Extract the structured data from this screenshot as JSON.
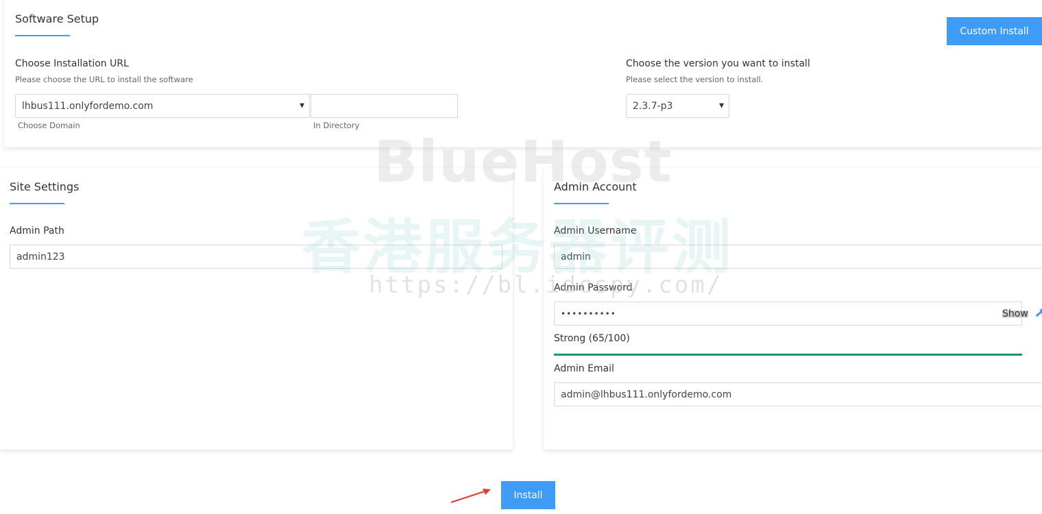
{
  "software_setup": {
    "title": "Software Setup",
    "custom_install_label": "Custom Install",
    "install_url": {
      "label": "Choose Installation URL",
      "hint": "Please choose the URL to install the software",
      "domain_value": "lhbus111.onlyfordemo.com",
      "domain_sublabel": "Choose Domain",
      "directory_value": "",
      "directory_sublabel": "In Directory"
    },
    "version": {
      "label": "Choose the version you want to install",
      "hint": "Please select the version to install.",
      "value": "2.3.7-p3"
    }
  },
  "site_settings": {
    "title": "Site Settings",
    "admin_path_label": "Admin Path",
    "admin_path_value": "admin123"
  },
  "admin_account": {
    "title": "Admin Account",
    "username_label": "Admin Username",
    "username_value": "admin",
    "password_label": "Admin Password",
    "password_value": "••••••••••",
    "show_label": "Show",
    "strength_text": "Strong (65/100)",
    "strength_fraction": 0.65,
    "email_label": "Admin Email",
    "email_value": "admin@lhbus111.onlyfordemo.com"
  },
  "install_button_label": "Install",
  "watermark": {
    "brand": "BlueHost",
    "chinese": "香港服务器评测",
    "url": "https://bl.idcspy.com/"
  },
  "colors": {
    "accent": "#3f9cf6",
    "strength": "#17956e",
    "arrow": "#e53935"
  },
  "icons": {
    "key": "key-icon",
    "arrow": "red-arrow-annotation"
  }
}
